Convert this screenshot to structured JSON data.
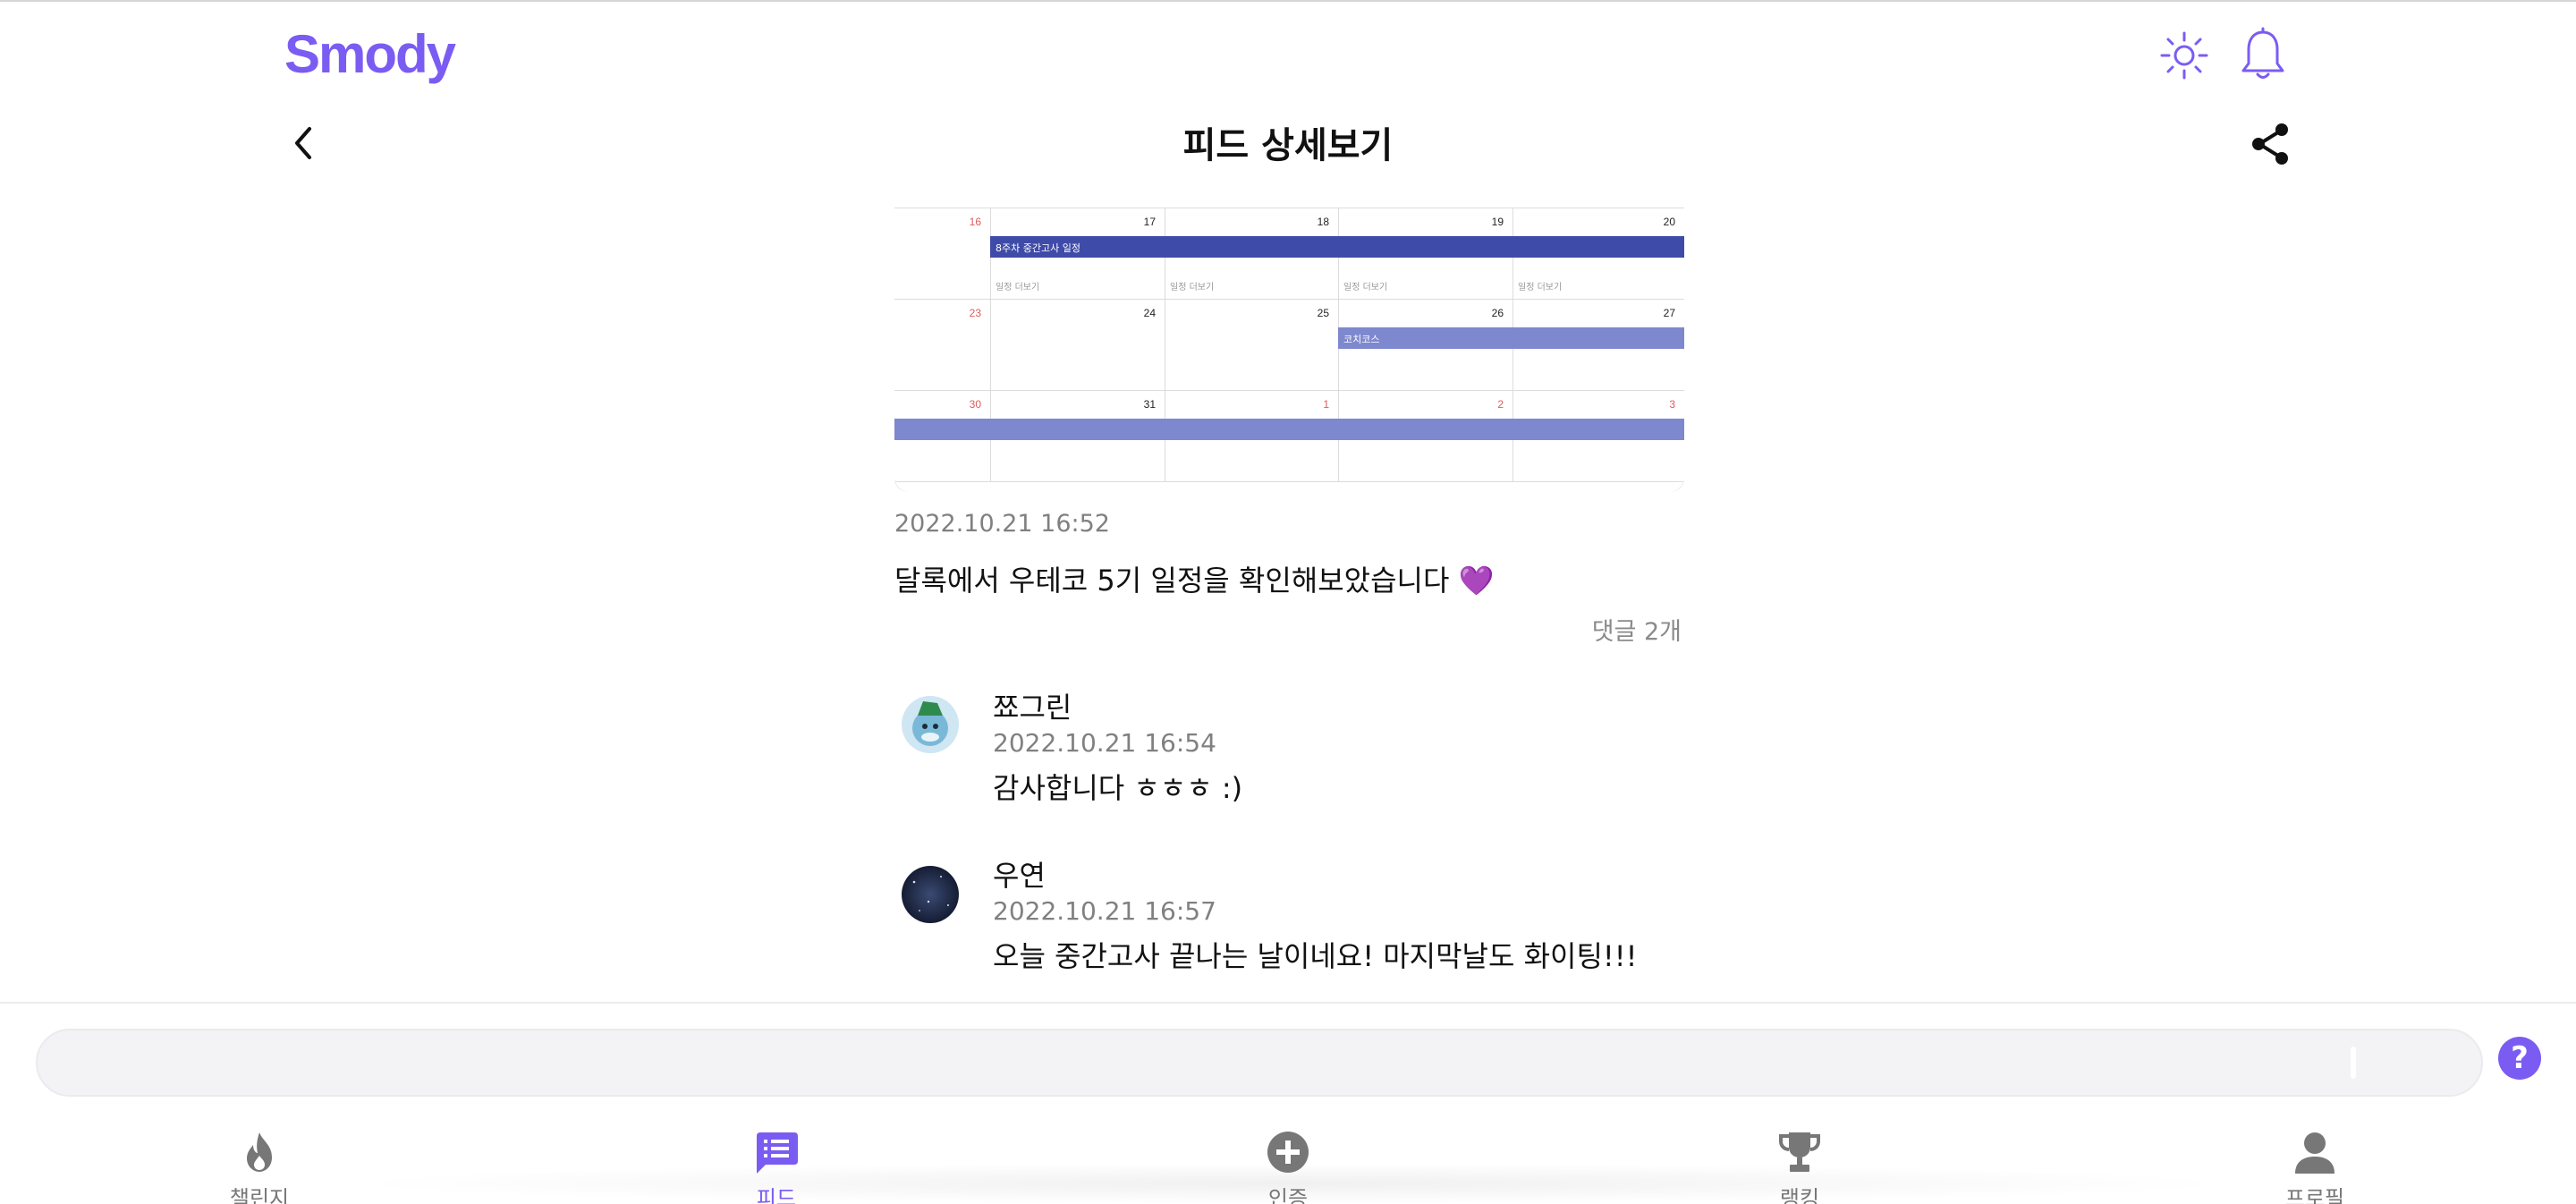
{
  "header": {
    "logo": "Smody",
    "theme_icon": "sun-icon",
    "notification_icon": "bell-icon"
  },
  "page": {
    "title": "피드 상세보기",
    "back_icon": "chevron-left-icon",
    "share_icon": "share-icon"
  },
  "feed": {
    "image": {
      "type": "calendar-screenshot",
      "rows": [
        {
          "days": [
            {
              "num": "16",
              "sunday": true,
              "note": ""
            },
            {
              "num": "17",
              "note": "일정 더보기"
            },
            {
              "num": "18",
              "note": "일정 더보기"
            },
            {
              "num": "19",
              "note": "일정 더보기"
            },
            {
              "num": "20",
              "note": "일정 더보기"
            }
          ],
          "event": "8주차 중간고사 일정"
        },
        {
          "days": [
            {
              "num": "23",
              "sunday": true,
              "note": ""
            },
            {
              "num": "24",
              "note": ""
            },
            {
              "num": "25",
              "note": ""
            },
            {
              "num": "26",
              "note": ""
            },
            {
              "num": "27",
              "note": ""
            }
          ],
          "event": "코치코스"
        },
        {
          "days": [
            {
              "num": "30",
              "sunday": true,
              "note": ""
            },
            {
              "num": "31",
              "note": ""
            },
            {
              "num": "1",
              "nextmonth": true,
              "note": ""
            },
            {
              "num": "2",
              "nextmonth": true,
              "note": ""
            },
            {
              "num": "3",
              "nextmonth": true,
              "note": ""
            }
          ],
          "event": ""
        }
      ],
      "colors": {
        "event_dark": "#3F4BA8",
        "event_light": "#7E88CF",
        "sunday": "#E05A5A"
      }
    },
    "timestamp": "2022.10.21 16:52",
    "text": "달록에서 우테코 5기 일정을 확인해보았습니다 💜",
    "comment_count": "댓글 2개"
  },
  "comments": [
    {
      "name": "쬬그린",
      "time": "2022.10.21 16:54",
      "text": "감사합니다 ㅎㅎㅎ :)"
    },
    {
      "name": "우연",
      "time": "2022.10.21 16:57",
      "text": "오늘 중간고사 끝나는 날이네요! 마지막날도 화이팅!!!"
    }
  ],
  "comment_input": {
    "value": "",
    "placeholder": ""
  },
  "help": {
    "label": "?"
  },
  "nav": {
    "items": [
      {
        "label": "챌린지",
        "icon": "fire-icon"
      },
      {
        "label": "피드",
        "icon": "feed-icon"
      },
      {
        "label": "인증",
        "icon": "plus-circle-icon"
      },
      {
        "label": "랭킹",
        "icon": "trophy-icon"
      },
      {
        "label": "프로필",
        "icon": "person-icon"
      }
    ]
  },
  "colors": {
    "brand": "#7B5CF2",
    "muted": "#808080"
  }
}
